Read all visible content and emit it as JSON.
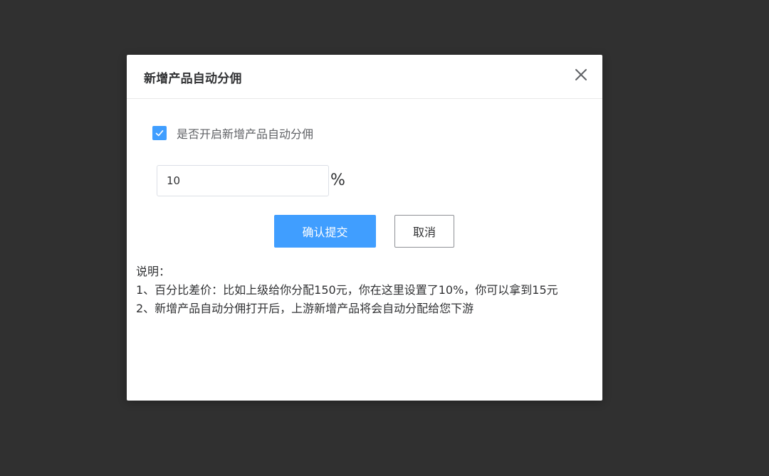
{
  "dialog": {
    "title": "新增产品自动分佣",
    "close_icon": "close-icon"
  },
  "form": {
    "enable_checkbox": {
      "label": "是否开启新增产品自动分佣",
      "checked": true,
      "color": "#409eff"
    },
    "percent_input": {
      "value": "10",
      "unit": "%"
    }
  },
  "buttons": {
    "confirm_label": "确认提交",
    "cancel_label": "取消"
  },
  "notes": {
    "heading": "说明：",
    "line1": "1、百分比差价：比如上级给你分配150元，你在这里设置了10%，你可以拿到15元",
    "line2": "2、新增产品自动分佣打开后，上游新增产品将会自动分配给您下游"
  },
  "colors": {
    "overlay": "#303030",
    "primary": "#409eff"
  }
}
